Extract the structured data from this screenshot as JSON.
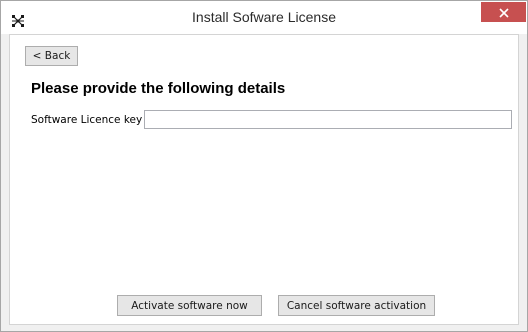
{
  "window": {
    "title": "Install Sofware License",
    "app_icon": "network-grid-icon",
    "close_icon": "close-icon"
  },
  "toolbar": {
    "back_label": "< Back"
  },
  "form": {
    "heading": "Please provide the following details",
    "license_key_label": "Software Licence key",
    "license_key_value": "",
    "license_key_placeholder": ""
  },
  "actions": {
    "activate_label": "Activate software now",
    "cancel_label": "Cancel software activation"
  },
  "colors": {
    "close_button_bg": "#c75050",
    "button_bg": "#e6e6e6",
    "button_border": "#adadad",
    "window_border": "#a6a6a6"
  }
}
